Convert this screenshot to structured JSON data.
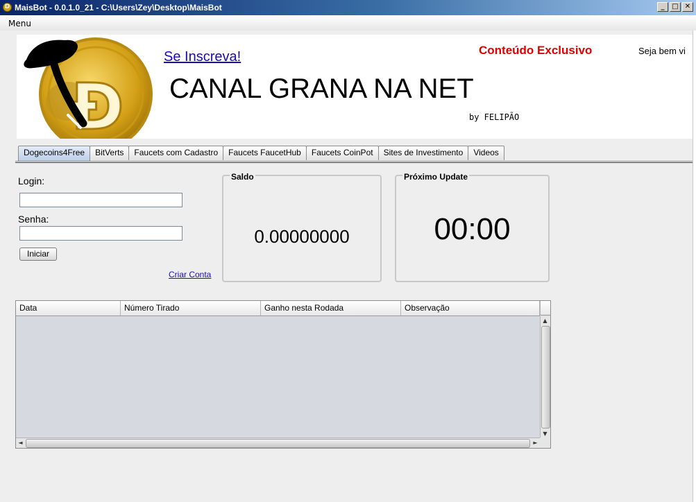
{
  "window": {
    "title": "MaisBot - 0.0.1.0_21 - C:\\Users\\Zey\\Desktop\\MaisBot",
    "minimize_label": "_",
    "maximize_label": "□",
    "close_label": "✕"
  },
  "menubar": {
    "menu_label": "Menu"
  },
  "banner": {
    "subscribe_link": "Se Inscreva!",
    "channel_title": "CANAL GRANA NA NET",
    "byline": "by FELIPÃO",
    "exclusive": "Conteúdo Exclusivo",
    "welcome": "Seja bem vi",
    "logo_letter": "Đ"
  },
  "tabs": [
    {
      "label": "Dogecoins4Free",
      "active": true
    },
    {
      "label": "BitVerts"
    },
    {
      "label": "Faucets com Cadastro"
    },
    {
      "label": "Faucets FaucetHub"
    },
    {
      "label": "Faucets CoinPot"
    },
    {
      "label": "Sites de Investimento"
    },
    {
      "label": "Videos"
    }
  ],
  "login_form": {
    "login_label": "Login:",
    "login_value": "",
    "password_label": "Senha:",
    "password_value": "",
    "start_button": "Iniciar",
    "create_account_link": "Criar Conta"
  },
  "balance_panel": {
    "title": "Saldo",
    "value": "0.00000000"
  },
  "update_panel": {
    "title": "Próximo Update",
    "value": "00:00"
  },
  "table": {
    "columns": [
      "Data",
      "Número Tirado",
      "Ganho nesta Rodada",
      "Observação"
    ],
    "rows": []
  },
  "colors": {
    "titlebar_start": "#0a246a",
    "exclusive_text": "#e00000",
    "link": "#1a0dab",
    "coin_gold": "#d4a017"
  },
  "icons": {
    "app_icon": "dogecoin-coin-icon",
    "scroll_up": "arrow-up-icon",
    "scroll_down": "arrow-down-icon",
    "scroll_left": "arrow-left-icon",
    "scroll_right": "arrow-right-icon"
  }
}
